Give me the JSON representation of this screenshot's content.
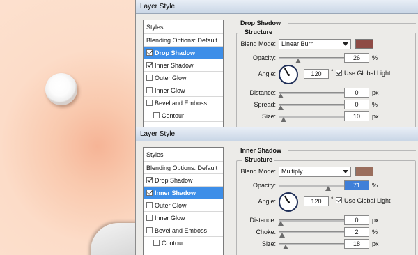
{
  "dialogs": [
    {
      "title": "Layer Style",
      "styles_header": "Styles",
      "blending_options": "Blending Options: Default",
      "list": [
        {
          "label": "Drop Shadow",
          "checked": true,
          "selected": true
        },
        {
          "label": "Inner Shadow",
          "checked": true,
          "selected": false
        },
        {
          "label": "Outer Glow",
          "checked": false,
          "selected": false
        },
        {
          "label": "Inner Glow",
          "checked": false,
          "selected": false
        },
        {
          "label": "Bevel and Emboss",
          "checked": false,
          "selected": false
        },
        {
          "label": "Contour",
          "checked": false,
          "selected": false
        }
      ],
      "panel": {
        "section": "Drop Shadow",
        "group": "Structure",
        "blend_mode_label": "Blend Mode:",
        "blend_mode": "Linear Burn",
        "color": "#8e4b45",
        "opacity_label": "Opacity:",
        "opacity": "26",
        "opacity_unit": "%",
        "angle_label": "Angle:",
        "angle": "120",
        "angle_unit": "°",
        "use_global_light": "Use Global Light",
        "use_global_light_checked": true,
        "distance_label": "Distance:",
        "distance": "0",
        "distance_unit": "px",
        "third_label": "Spread:",
        "third_value": "0",
        "third_unit": "%",
        "size_label": "Size:",
        "size": "10",
        "size_unit": "px"
      }
    },
    {
      "title": "Layer Style",
      "styles_header": "Styles",
      "blending_options": "Blending Options: Default",
      "list": [
        {
          "label": "Drop Shadow",
          "checked": true,
          "selected": false
        },
        {
          "label": "Inner Shadow",
          "checked": true,
          "selected": true
        },
        {
          "label": "Outer Glow",
          "checked": false,
          "selected": false
        },
        {
          "label": "Inner Glow",
          "checked": false,
          "selected": false
        },
        {
          "label": "Bevel and Emboss",
          "checked": false,
          "selected": false
        },
        {
          "label": "Contour",
          "checked": false,
          "selected": false
        }
      ],
      "panel": {
        "section": "Inner Shadow",
        "group": "Structure",
        "blend_mode_label": "Blend Mode:",
        "blend_mode": "Multiply",
        "color": "#9a6e5d",
        "opacity_label": "Opacity:",
        "opacity": "71",
        "opacity_unit": "%",
        "angle_label": "Angle:",
        "angle": "120",
        "angle_unit": "°",
        "use_global_light": "Use Global Light",
        "use_global_light_checked": true,
        "distance_label": "Distance:",
        "distance": "0",
        "distance_unit": "px",
        "third_label": "Choke:",
        "third_value": "2",
        "third_unit": "%",
        "size_label": "Size:",
        "size": "18",
        "size_unit": "px"
      }
    }
  ]
}
